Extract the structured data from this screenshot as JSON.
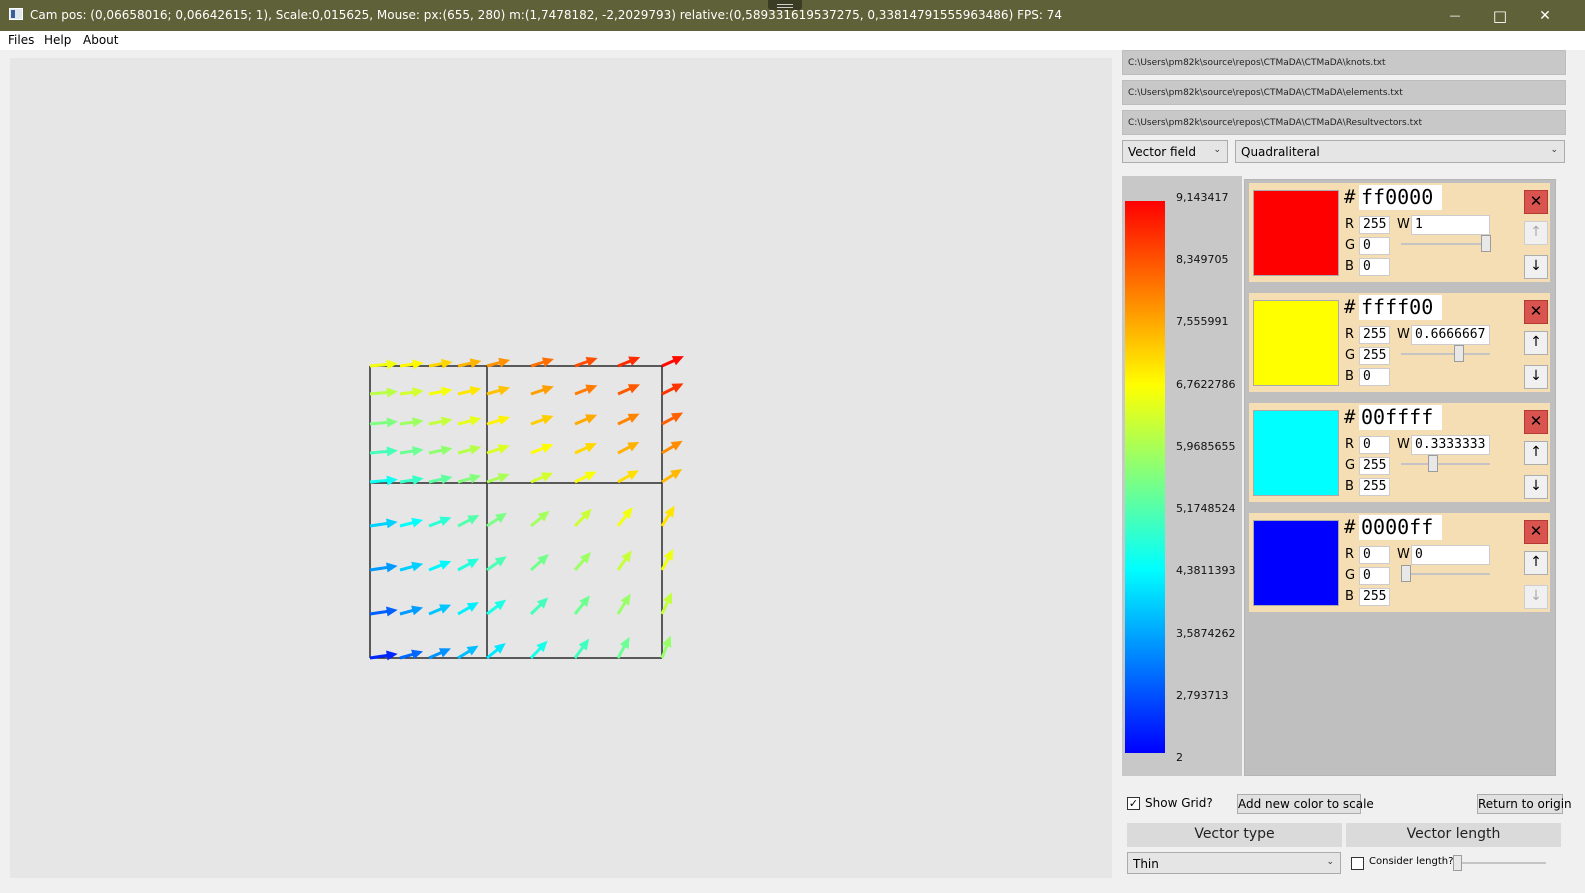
{
  "window": {
    "title": "Cam pos: (0,06658016; 0,06642615; 1), Scale:0,015625, Mouse: px:(655, 280) m:(1,7478182, -2,2029793) relative:(0,589331619537275, 0,33814791555963486) FPS: 74",
    "minimize": "—",
    "maximize": "□",
    "close": "✕"
  },
  "menu": {
    "files": "Files",
    "help": "Help",
    "about": "About"
  },
  "paths": {
    "knots": "C:\\Users\\pm82k\\source\\repos\\CTMaDA\\CTMaDA\\knots.txt",
    "elements": "C:\\Users\\pm82k\\source\\repos\\CTMaDA\\CTMaDA\\elements.txt",
    "results": "C:\\Users\\pm82k\\source\\repos\\CTMaDA\\CTMaDA\\Resultvectors.txt"
  },
  "mode_select": {
    "selected": "Vector field"
  },
  "element_select": {
    "selected": "Quadraliteral"
  },
  "color_scale": {
    "labels": [
      "9,143417",
      "8,349705",
      "7,555991",
      "6,7622786",
      "5,9685655",
      "5,1748524",
      "4,3811393",
      "3,5874262",
      "2,793713",
      "2"
    ],
    "gradient_colors": [
      "#ff0000",
      "#ffff00",
      "#00ffff",
      "#0000ff"
    ]
  },
  "colors": [
    {
      "hash": "#",
      "hex": "ff0000",
      "swatch": "#ff0000",
      "r_label": "R",
      "g_label": "G",
      "b_label": "B",
      "w_label": "W",
      "r": "255",
      "g": "0",
      "b": "0",
      "w": "1",
      "w_fraction": 1.0,
      "up_enabled": false,
      "down_enabled": true
    },
    {
      "hash": "#",
      "hex": "ffff00",
      "swatch": "#ffff00",
      "r_label": "R",
      "g_label": "G",
      "b_label": "B",
      "w_label": "W",
      "r": "255",
      "g": "255",
      "b": "0",
      "w": "0.6666667",
      "w_fraction": 0.6666667,
      "up_enabled": true,
      "down_enabled": true
    },
    {
      "hash": "#",
      "hex": "00ffff",
      "swatch": "#00ffff",
      "r_label": "R",
      "g_label": "G",
      "b_label": "B",
      "w_label": "W",
      "r": "0",
      "g": "255",
      "b": "255",
      "w": "0.3333333",
      "w_fraction": 0.3333333,
      "up_enabled": true,
      "down_enabled": true
    },
    {
      "hash": "#",
      "hex": "0000ff",
      "swatch": "#0000ff",
      "r_label": "R",
      "g_label": "G",
      "b_label": "B",
      "w_label": "W",
      "r": "0",
      "g": "0",
      "b": "255",
      "w": "0",
      "w_fraction": 0.0,
      "up_enabled": true,
      "down_enabled": false
    }
  ],
  "icons": {
    "delete": "✕",
    "up": "↑",
    "down": "↓",
    "check": "✓",
    "dropdown": "⌄"
  },
  "show_grid": {
    "label": "Show Grid?",
    "checked": true
  },
  "add_color_button": "Add new color to scale",
  "return_origin_button": "Return to origin",
  "vector_type": {
    "header": "Vector type",
    "selected": "Thin"
  },
  "vector_length": {
    "header": "Vector length",
    "consider_label": "Consider length?",
    "checked": false,
    "slider_fraction": 0.0
  }
}
